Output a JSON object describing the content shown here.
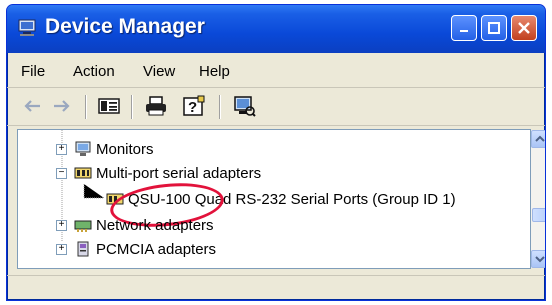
{
  "window": {
    "title": "Device Manager"
  },
  "menu": [
    "File",
    "Action",
    "View",
    "Help"
  ],
  "toolbar": {
    "icons": [
      "back-arrow-icon",
      "forward-arrow-icon",
      "properties-icon",
      "print-icon",
      "help-icon",
      "scan-hardware-icon"
    ]
  },
  "tree": {
    "items": [
      {
        "label": "Monitors",
        "expander": "+",
        "icon": "monitor-icon"
      },
      {
        "label": "Multi-port serial adapters",
        "expander": "−",
        "icon": "serial-adapter-icon"
      },
      {
        "label": "QSU-100 Quad RS-232 Serial Ports (Group ID 1)",
        "expander": "",
        "icon": "serial-port-icon",
        "highlight": "QSU-100"
      },
      {
        "label": "Network adapters",
        "expander": "+",
        "icon": "network-icon"
      },
      {
        "label": "PCMCIA adapters",
        "expander": "+",
        "icon": "pcmcia-icon"
      }
    ]
  },
  "colors": {
    "titlebar": "#0a49d8",
    "highlight_ring": "#e2123b"
  }
}
